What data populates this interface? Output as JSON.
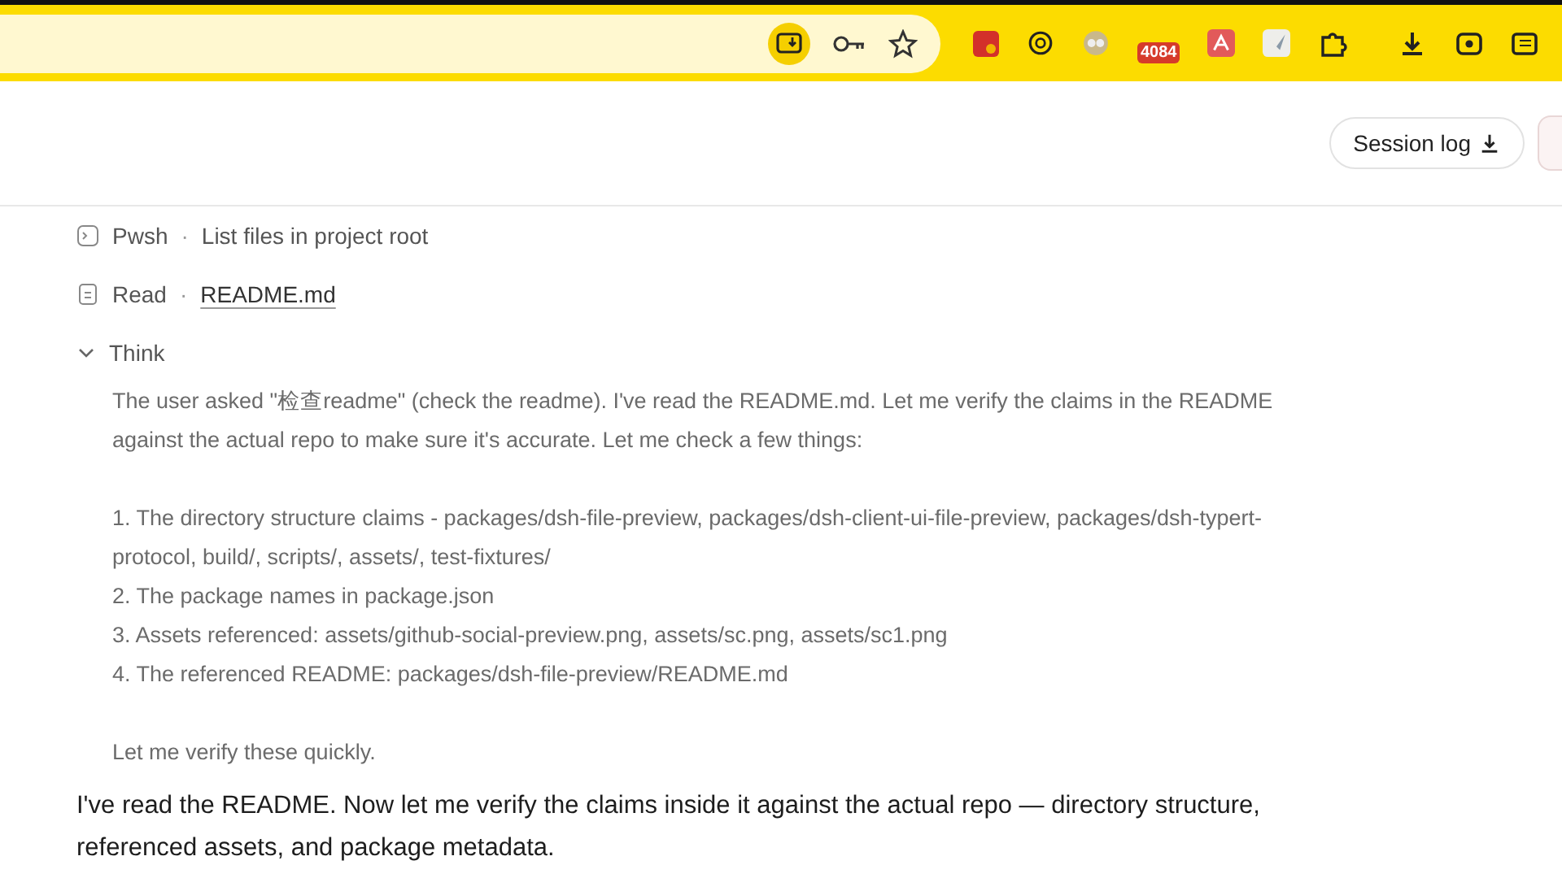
{
  "browser": {
    "extension_badge": "4084"
  },
  "header": {
    "session_log_button": "Session log"
  },
  "steps": [
    {
      "kind": "tool",
      "name": "Pwsh",
      "separator": "·",
      "detail": "List files in project root"
    },
    {
      "kind": "tool",
      "name": "Read",
      "separator": "·",
      "detail": "README.md"
    },
    {
      "kind": "think",
      "title": "Think",
      "expanded": true,
      "paragraphs": [
        [
          "The user asked \"检查readme\" (check the readme). I've read the README.md. Let me verify the claims in the README against the actual repo to make sure it's accurate. Let me check a few things:"
        ],
        [
          "1. The directory structure claims - packages/dsh-file-preview, packages/dsh-client-ui-file-preview, packages/dsh-typert-protocol, build/, scripts/, assets/, test-fixtures/",
          "2. The package names in package.json",
          "3. Assets referenced: assets/github-social-preview.png, assets/sc.png, assets/sc1.png",
          "4. The referenced README: packages/dsh-file-preview/README.md"
        ],
        [
          "Let me verify these quickly."
        ]
      ]
    }
  ],
  "answer": "I've read the README. Now let me verify the claims inside it against the actual repo — directory structure, referenced assets, and package metadata."
}
